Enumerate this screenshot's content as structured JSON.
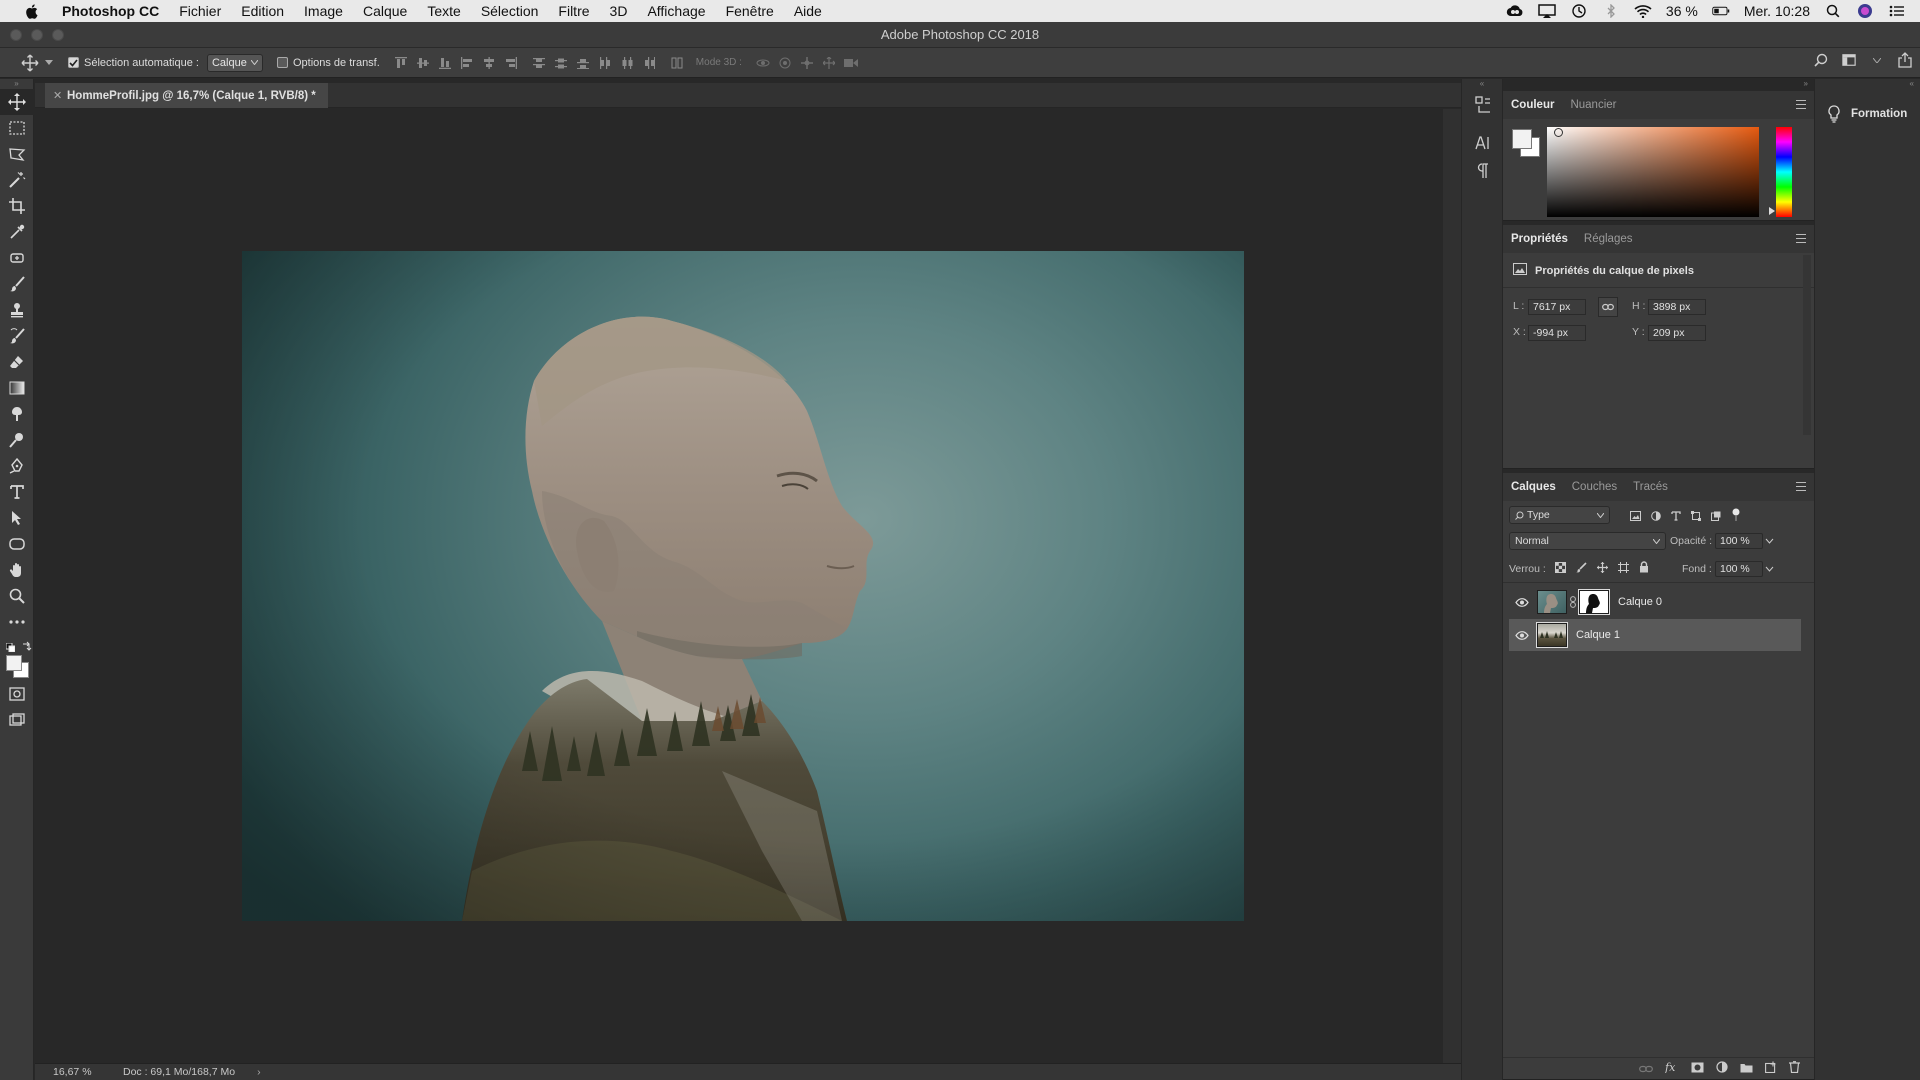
{
  "menubar": {
    "app_name": "Photoshop CC",
    "items": [
      "Fichier",
      "Edition",
      "Image",
      "Calque",
      "Texte",
      "Sélection",
      "Filtre",
      "3D",
      "Affichage",
      "Fenêtre",
      "Aide"
    ],
    "battery": "36 %",
    "clock": "Mer. 10:28"
  },
  "window": {
    "title": "Adobe Photoshop CC 2018"
  },
  "options": {
    "auto_select_label": "Sélection automatique :",
    "auto_select_checked": true,
    "auto_select_target": "Calque",
    "transform_controls_label": "Options de transf.",
    "transform_controls_checked": false,
    "mode3d_label": "Mode 3D :"
  },
  "tools": [
    "move",
    "marquee",
    "lasso",
    "magic-wand",
    "crop",
    "eyedropper",
    "spot-healing",
    "brush",
    "clone-stamp",
    "history-brush",
    "eraser",
    "gradient",
    "blur",
    "dodge",
    "pen",
    "type",
    "path-selection",
    "shape",
    "hand",
    "zoom",
    "more"
  ],
  "document": {
    "tab_label": "HommeProfil.jpg @ 16,7% (Calque 1, RVB/8) *",
    "zoom": "16,67 %",
    "doc_size": "Doc : 69,1 Mo/168,7 Mo"
  },
  "panels": {
    "color": {
      "tabs": [
        "Couleur",
        "Nuancier"
      ],
      "active": 0
    },
    "properties": {
      "tabs": [
        "Propriétés",
        "Réglages"
      ],
      "active": 0,
      "heading": "Propriétés du calque de pixels",
      "w_label": "L :",
      "w_value": "7617 px",
      "h_label": "H :",
      "h_value": "3898 px",
      "x_label": "X :",
      "x_value": "-994 px",
      "y_label": "Y :",
      "y_value": "209 px"
    },
    "layers": {
      "tabs": [
        "Calques",
        "Couches",
        "Tracés"
      ],
      "active": 0,
      "filter_kind": "Type",
      "blend_mode": "Normal",
      "opacity_label": "Opacité :",
      "opacity_value": "100 %",
      "lock_label": "Verrou :",
      "fill_label": "Fond :",
      "fill_value": "100 %",
      "items": [
        {
          "name": "Calque 0",
          "visible": true,
          "selected": false,
          "has_mask": true
        },
        {
          "name": "Calque 1",
          "visible": true,
          "selected": true,
          "has_mask": false
        }
      ]
    }
  },
  "learn": {
    "label": "Formation"
  },
  "colors": {
    "foreground": "#f2f2f2",
    "background": "#ffffff",
    "hue_marker": "#e65a10"
  }
}
